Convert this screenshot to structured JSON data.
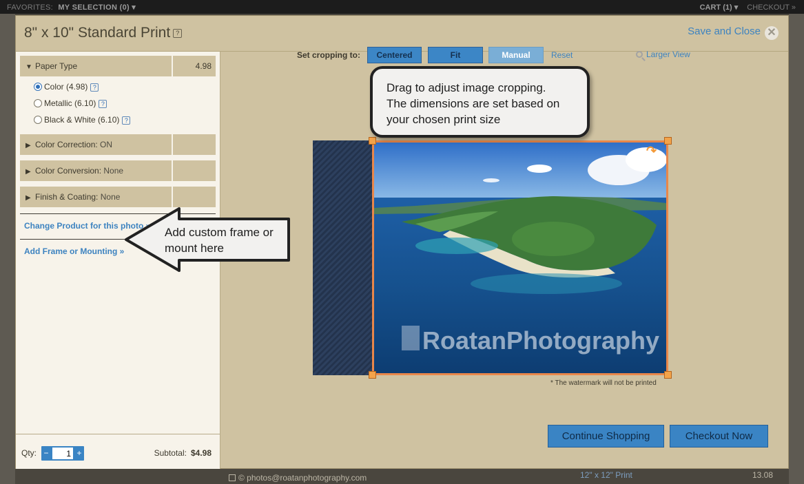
{
  "topbar": {
    "favorites_label": "FAVORITES:",
    "selection_label": "MY SELECTION (0) ▾",
    "cart_label": "CART (1) ▾",
    "checkout_label": "CHECKOUT »"
  },
  "background_footer": {
    "email": "© photos@roatanphotography.com",
    "print_name": "12\" x 12\" Print",
    "print_price": "13.08"
  },
  "modal": {
    "title": "8\" x 10\" Standard Print",
    "help": "?",
    "save_close_label": "Save and Close"
  },
  "options": {
    "paper_type": {
      "label": "Paper Type",
      "price": "4.98",
      "expanded": true
    },
    "paper_choices": [
      {
        "label": "Color (4.98)",
        "selected": true
      },
      {
        "label": "Metallic (6.10)",
        "selected": false
      },
      {
        "label": "Black & White (6.10)",
        "selected": false
      }
    ],
    "color_correction": {
      "label": "Color Correction:",
      "value": "ON"
    },
    "color_conversion": {
      "label": "Color Conversion:",
      "value": "None"
    },
    "finish_coating": {
      "label": "Finish & Coating:",
      "value": "None"
    }
  },
  "links": {
    "change_product": "Change Product for this photo »",
    "add_frame": "Add Frame or Mounting »"
  },
  "footer": {
    "qty_label": "Qty:",
    "qty_value": "1",
    "minus": "−",
    "plus": "+",
    "subtotal_label": "Subtotal:",
    "subtotal_value": "$4.98"
  },
  "cropping": {
    "label": "Set cropping to:",
    "centered": "Centered",
    "fit": "Fit",
    "manual": "Manual",
    "reset": "Reset",
    "larger_view": "Larger View",
    "active_mode": "Manual"
  },
  "image": {
    "watermark_text": "RoatanPhotography",
    "watermark_note": "* The watermark will not be printed"
  },
  "buttons": {
    "continue_shopping": "Continue Shopping",
    "checkout_now": "Checkout Now"
  },
  "callouts": {
    "crop_line1": "Drag to adjust image cropping.",
    "crop_line2": "The dimensions are set based on",
    "crop_line3": "your chosen print size",
    "frame_line1": "Add custom frame or",
    "frame_line2": "mount here"
  },
  "colors": {
    "modal_bg": "#cfc2a1",
    "panel_bg": "#f7f3ea",
    "accent_blue": "#3a84c4",
    "link_blue": "#3d83c0",
    "crop_frame": "#e9874a"
  },
  "icons": {
    "close": "close-icon",
    "magnifier": "magnifier-icon",
    "rotate": "rotate-icon",
    "email": "email-icon"
  }
}
